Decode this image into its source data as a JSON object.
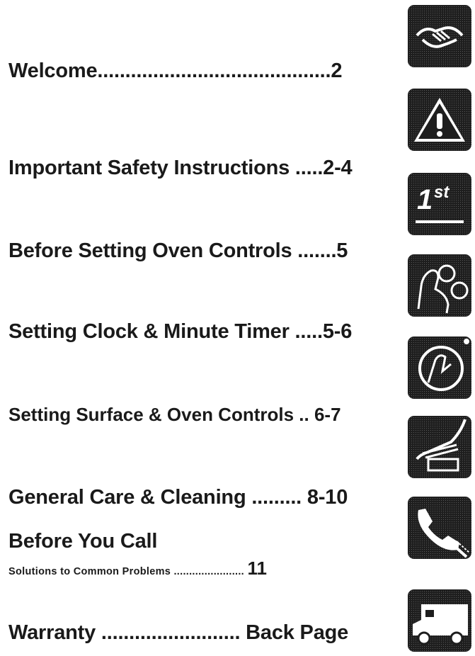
{
  "toc": [
    {
      "id": "welcome",
      "line": "Welcome..........................................2",
      "icon": "handshake-icon"
    },
    {
      "id": "safety",
      "line": "Important Safety Instructions .....2-4",
      "icon": "warning-icon"
    },
    {
      "id": "before-setting",
      "line": "Before Setting Oven Controls .......5",
      "icon": "first-icon"
    },
    {
      "id": "clock",
      "line": "Setting Clock & Minute Timer .....5-6",
      "icon": "hand-pressing-buttons-icon"
    },
    {
      "id": "surface",
      "line": "Setting Surface & Oven Controls .. 6-7",
      "icon": "hand-turning-knob-icon"
    },
    {
      "id": "care",
      "line": "General Care & Cleaning ......... 8-10",
      "icon": "hand-cleaning-icon"
    },
    {
      "id": "call",
      "title": "Before You  Call",
      "subline": "Solutions to Common Problems .......................",
      "page": "11",
      "icon": "telephone-icon"
    },
    {
      "id": "warranty",
      "line": "Warranty ......................... Back Page",
      "icon": "rv-truck-icon"
    }
  ]
}
